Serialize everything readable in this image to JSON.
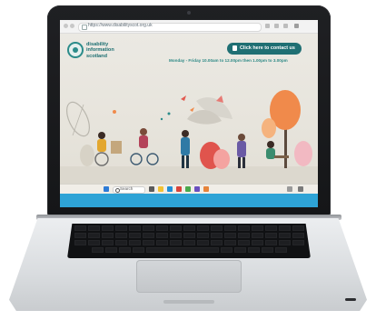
{
  "browser": {
    "url": "https://www.disabilityscot.org.uk"
  },
  "site": {
    "logo_line1": "disability",
    "logo_line2": "information",
    "logo_line3": "scotland",
    "cta_label": "Click here to contact us",
    "hours": "Monday - Friday 10.00am to 12.00pm then 1.00pm to 3.00pm"
  },
  "taskbar": {
    "search_label": "Search"
  },
  "colors": {
    "brand_teal": "#1f6f73",
    "screen_edge_blue": "#2ea3d6"
  }
}
